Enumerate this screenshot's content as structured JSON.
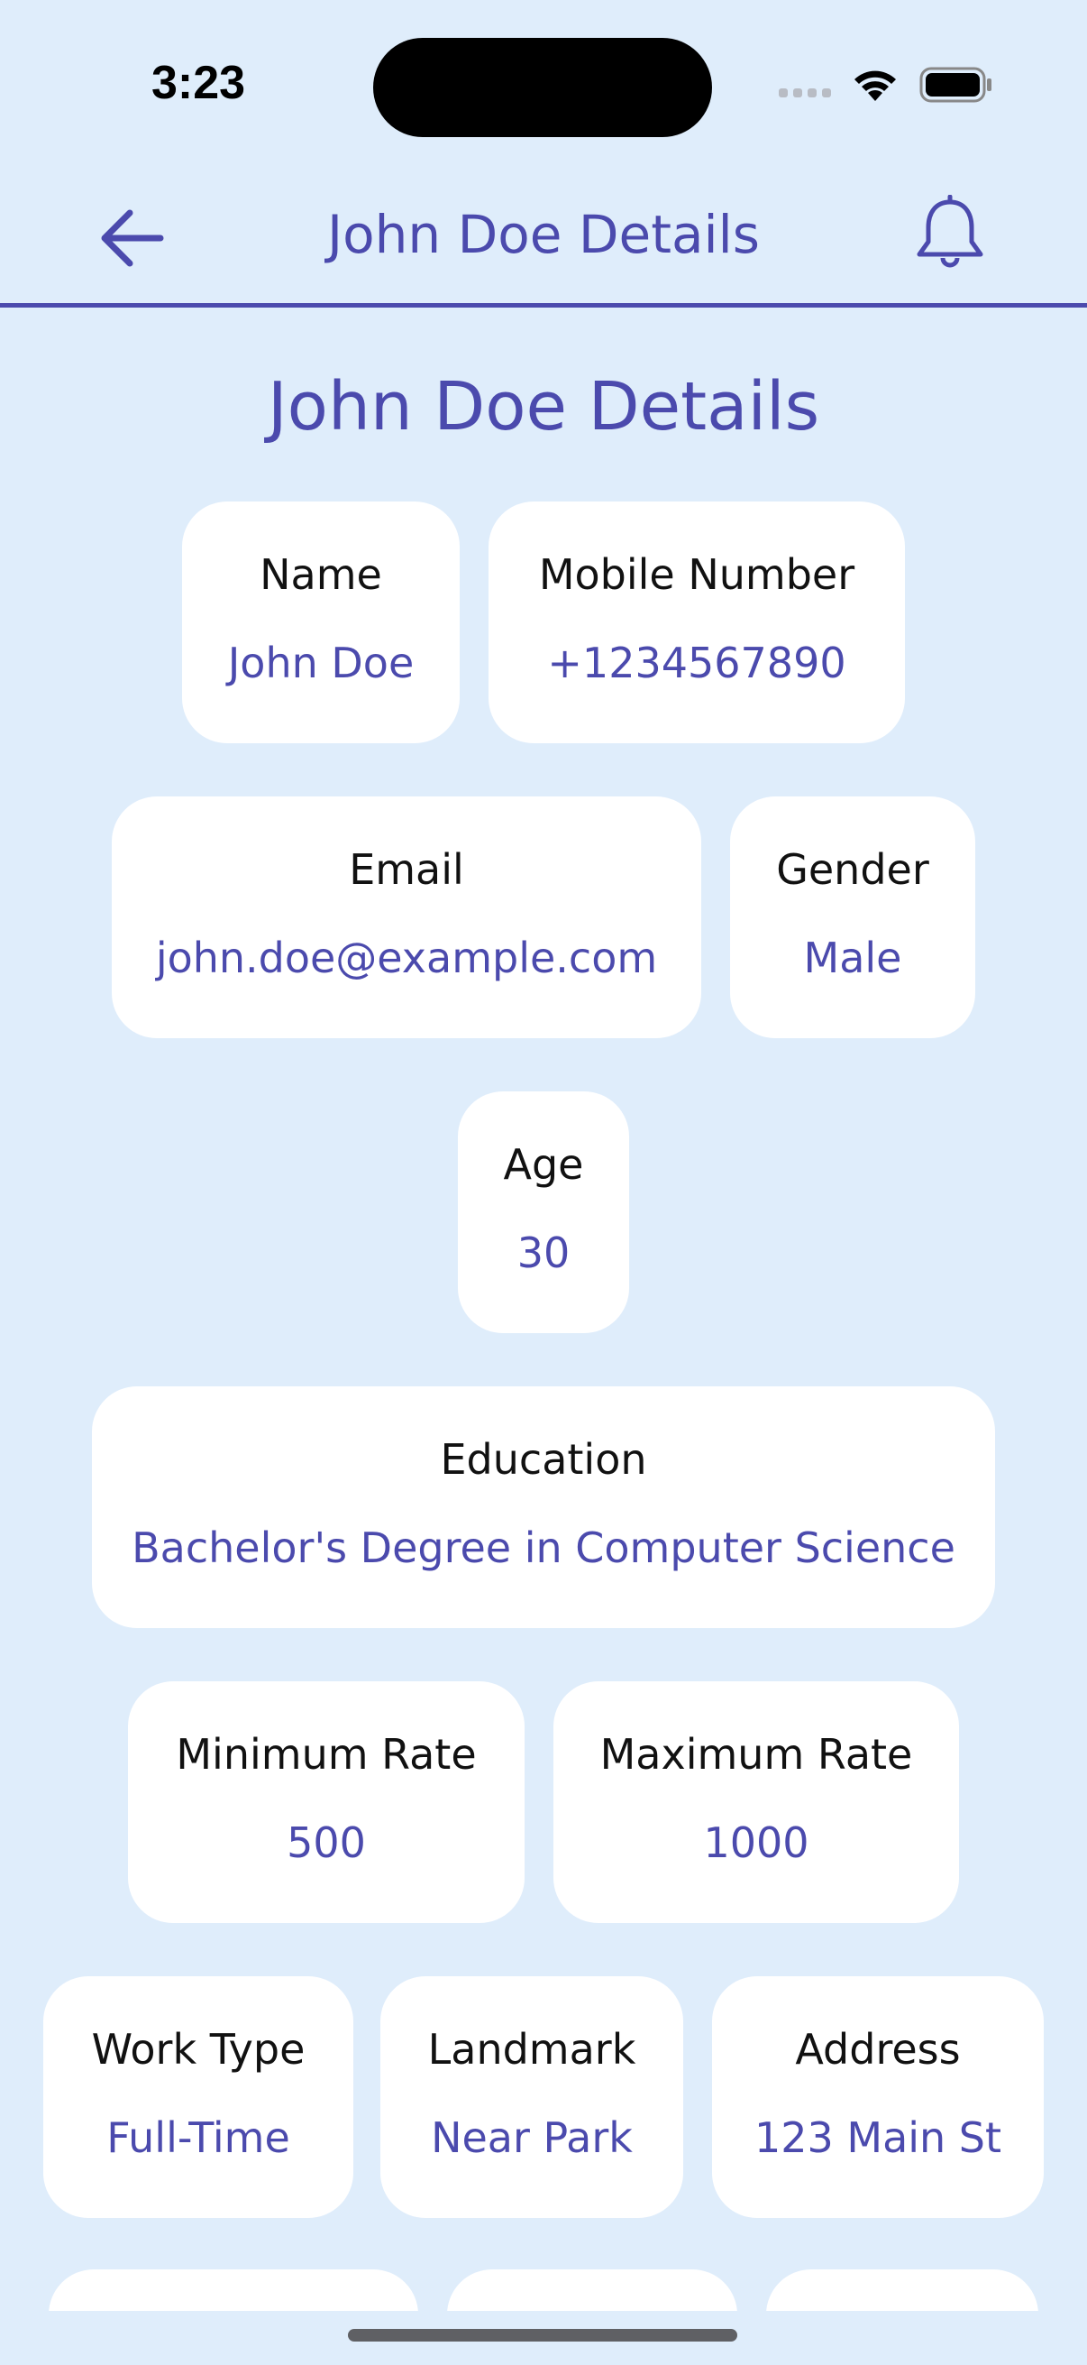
{
  "status_bar": {
    "time": "3:23"
  },
  "app_bar": {
    "title": "John Doe Details"
  },
  "page": {
    "heading": "John Doe Details"
  },
  "fields": {
    "name": {
      "label": "Name",
      "value": "John Doe"
    },
    "mobile": {
      "label": "Mobile Number",
      "value": "+1234567890"
    },
    "email": {
      "label": "Email",
      "value": "john.doe@example.com"
    },
    "gender": {
      "label": "Gender",
      "value": "Male"
    },
    "age": {
      "label": "Age",
      "value": "30"
    },
    "education": {
      "label": "Education",
      "value": "Bachelor's Degree in Computer Science"
    },
    "min_rate": {
      "label": "Minimum Rate",
      "value": "500"
    },
    "max_rate": {
      "label": "Maximum Rate",
      "value": "1000"
    },
    "work_type": {
      "label": "Work Type",
      "value": "Full-Time"
    },
    "landmark": {
      "label": "Landmark",
      "value": "Near Park"
    },
    "address": {
      "label": "Address",
      "value": "123 Main St"
    }
  },
  "icons": {
    "back": "arrow-left-icon",
    "notifications": "bell-icon",
    "cellular": "cellular-signal-icon",
    "wifi": "wifi-icon",
    "battery": "battery-icon"
  },
  "colors": {
    "background": "#dfedfb",
    "accent": "#4b4aad",
    "card": "#ffffff"
  }
}
